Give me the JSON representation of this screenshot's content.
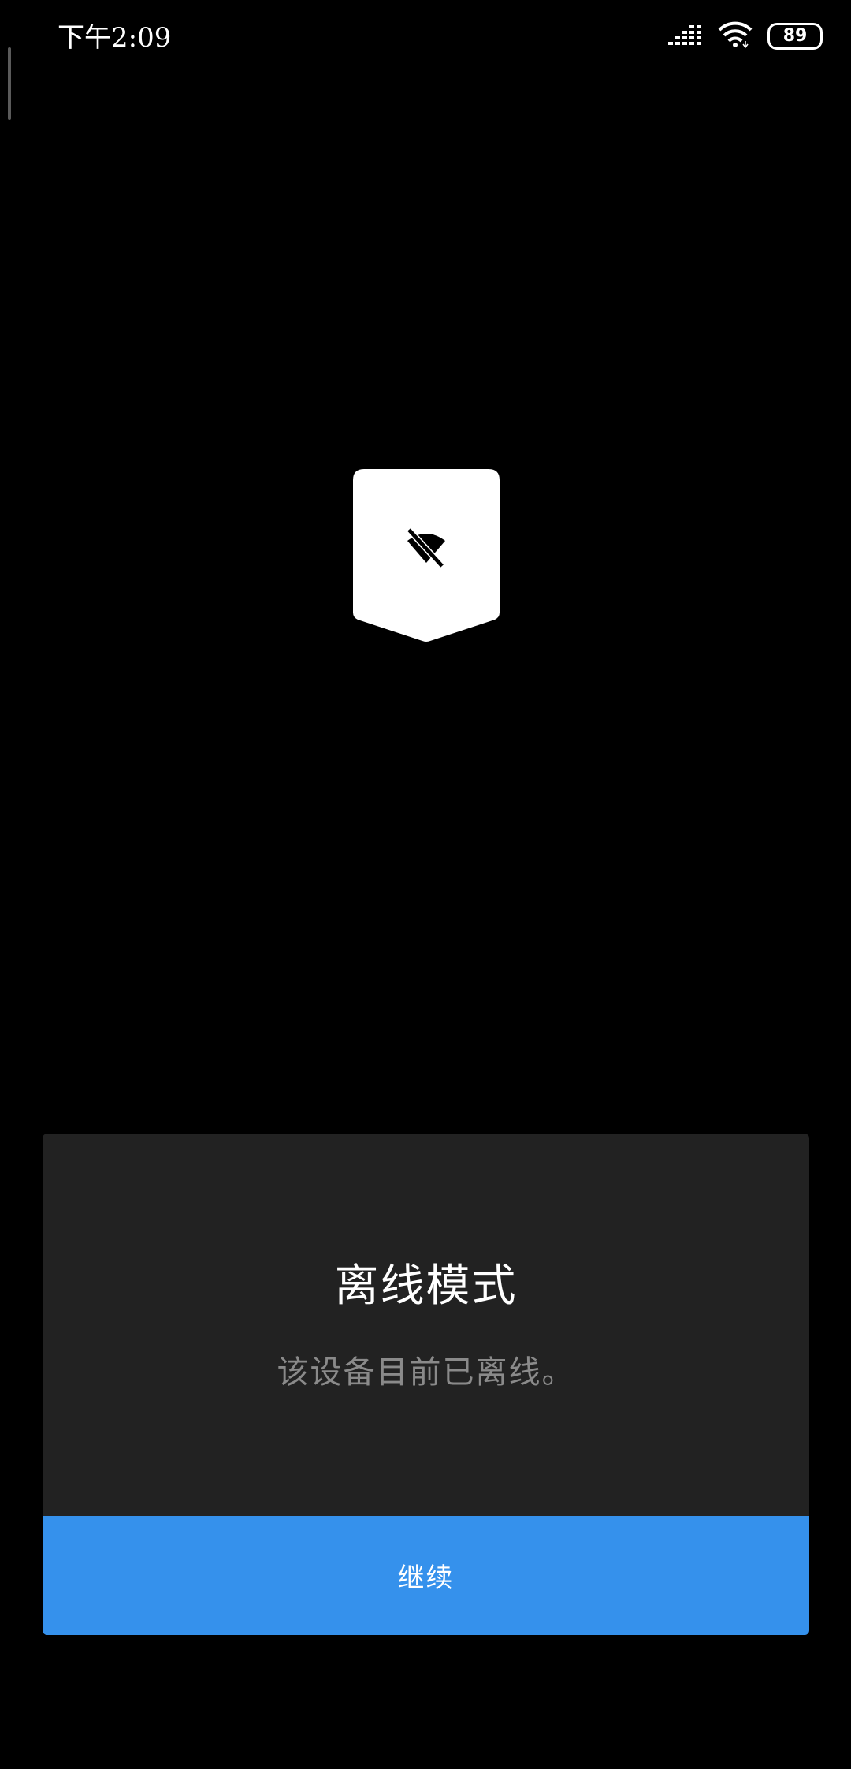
{
  "status_bar": {
    "time": "下午2:09",
    "battery_level": "89",
    "signal_icon": "signal-bars-icon",
    "wifi_icon": "wifi-icon"
  },
  "badge": {
    "icon": "wifi-off-icon",
    "background_color": "#ffffff"
  },
  "dialog": {
    "title": "离线模式",
    "message": "该设备目前已离线。",
    "continue_label": "继续",
    "background_color": "#222222",
    "button_color": "#3591ec"
  }
}
